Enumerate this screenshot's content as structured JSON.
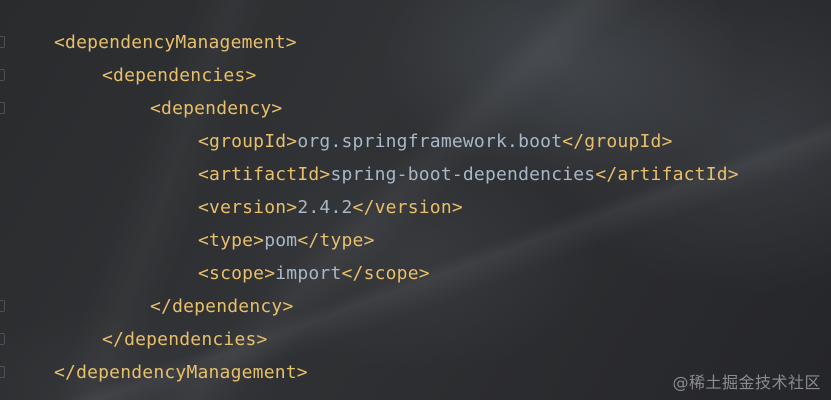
{
  "editor": {
    "lines": [
      {
        "tag_open": "<dependencyManagement>",
        "text": "",
        "tag_close": ""
      },
      {
        "tag_open": "<dependencies>",
        "text": "",
        "tag_close": ""
      },
      {
        "tag_open": "<dependency>",
        "text": "",
        "tag_close": ""
      },
      {
        "tag_open": "<groupId>",
        "text": "org.springframework.boot",
        "tag_close": "</groupId>"
      },
      {
        "tag_open": "<artifactId>",
        "text": "spring-boot-dependencies",
        "tag_close": "</artifactId>"
      },
      {
        "tag_open": "<version>",
        "text": "2.4.2",
        "tag_close": "</version>"
      },
      {
        "tag_open": "<type>",
        "text": "pom",
        "tag_close": "</type>"
      },
      {
        "tag_open": "<scope>",
        "text": "import",
        "tag_close": "</scope>"
      },
      {
        "tag_open": "</dependency>",
        "text": "",
        "tag_close": ""
      },
      {
        "tag_open": "</dependencies>",
        "text": "",
        "tag_close": ""
      },
      {
        "tag_open": "</dependencyManagement>",
        "text": "",
        "tag_close": ""
      }
    ]
  },
  "watermark": {
    "text": "@稀土掘金技术社区"
  },
  "colors": {
    "tag": "#e8bf6a",
    "text": "#a9b7c6",
    "background": "#2b2c2e"
  }
}
